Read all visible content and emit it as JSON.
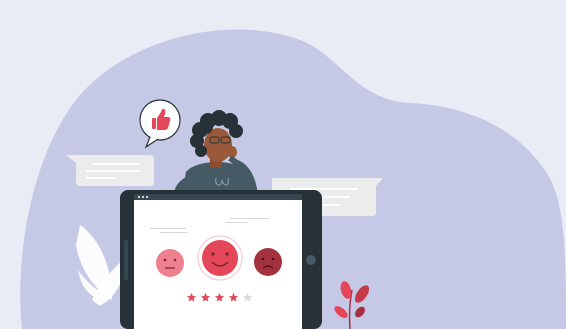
{
  "colors": {
    "background": "#e9ebf5",
    "blob": "#c5c9e6",
    "tablet_frame": "#263238",
    "tablet_screen": "#ffffff",
    "accent_red": "#e5475a",
    "face_light": "#ef8090",
    "face_dark": "#a3323e",
    "star_empty": "#dadada",
    "hair": "#263238",
    "sweater": "#455a64",
    "skin": "#9a5a3a"
  },
  "icons": {
    "thumbs_up": "thumbs-up-icon",
    "faces": [
      "neutral-face-icon",
      "happy-face-icon",
      "sad-face-icon"
    ],
    "star": "star-icon"
  },
  "rating": {
    "value": 4,
    "max": 5
  }
}
